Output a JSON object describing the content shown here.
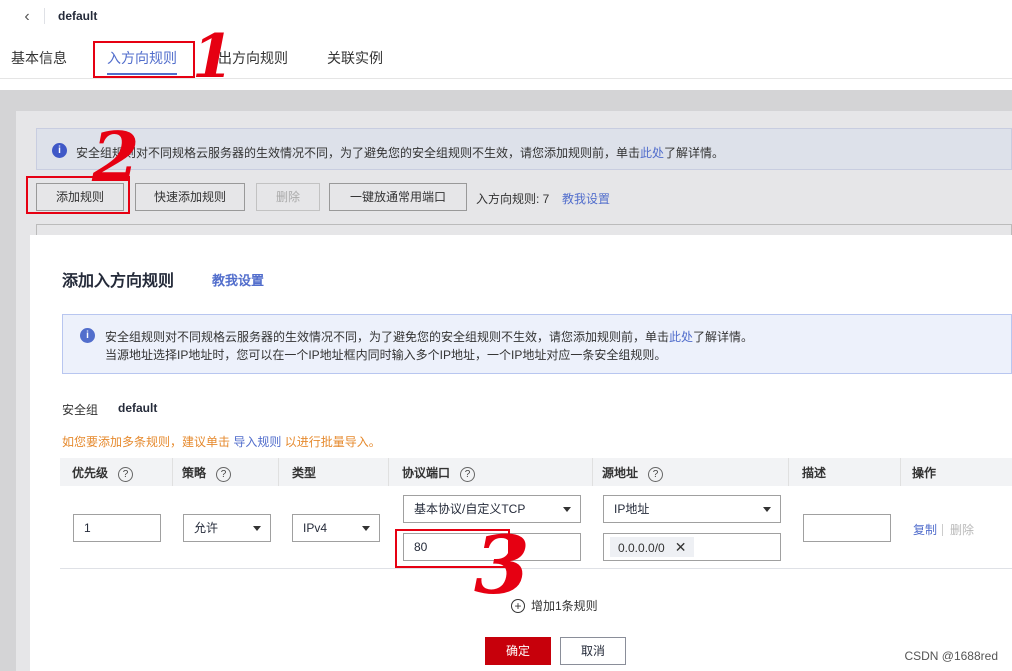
{
  "header": {
    "title": "default",
    "tabs": [
      "基本信息",
      "入方向规则",
      "出方向规则",
      "关联实例"
    ]
  },
  "background": {
    "info_text": "安全组规则对不同规格云服务器的生效情况不同，为了避免您的安全组规则不生效，请您添加规则前，单击",
    "info_link": "此处",
    "info_suffix": "了解详情。",
    "buttons": {
      "add": "添加规则",
      "quick_add": "快速添加规则",
      "delete": "删除",
      "open_ports": "一键放通常用端口"
    },
    "rule_count": "入方向规则: 7",
    "teach": "教我设置"
  },
  "annotations": [
    "1",
    "2",
    "3"
  ],
  "modal": {
    "title": "添加入方向规则",
    "teach": "教我设置",
    "info_line1": "安全组规则对不同规格云服务器的生效情况不同，为了避免您的安全组规则不生效，请您添加规则前，单击",
    "info_link": "此处",
    "info_suffix": "了解详情。",
    "info_line2": "当源地址选择IP地址时，您可以在一个IP地址框内同时输入多个IP地址，一个IP地址对应一条安全组规则。",
    "sg_label": "安全组",
    "sg_value": "default",
    "warn_prefix": "如您要添加多条规则，建议单击",
    "warn_link": "导入规则",
    "warn_suffix": "以进行批量导入。",
    "columns": [
      "优先级",
      "策略",
      "类型",
      "协议端口",
      "源地址",
      "描述",
      "操作"
    ],
    "row": {
      "priority": "1",
      "policy": "允许",
      "type": "IPv4",
      "protocol": "基本协议/自定义TCP",
      "port": "80",
      "source_type": "IP地址",
      "source_ip": "0.0.0.0/0",
      "description": "",
      "copy": "复制",
      "delete": "删除"
    },
    "add_row": "增加1条规则",
    "ok": "确定",
    "cancel": "取消"
  },
  "watermark": "CSDN @1688red"
}
